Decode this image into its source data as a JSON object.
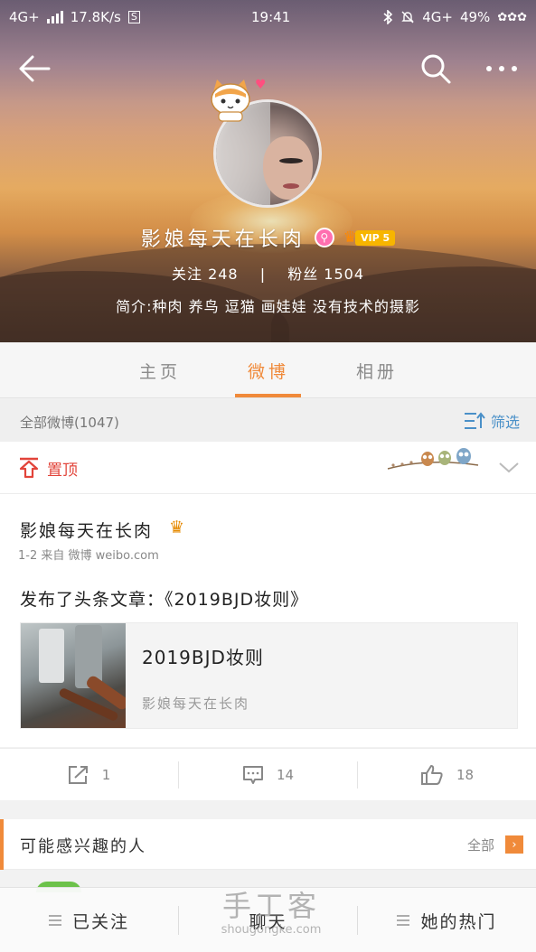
{
  "statusbar": {
    "network": "4G+",
    "speed": "17.8K/s",
    "s_badge": "S",
    "time": "19:41",
    "network2": "4G+",
    "battery": "49%"
  },
  "profile": {
    "username": "影娘每天在长肉",
    "vip_label": "VIP 5",
    "follow_text": "关注 248",
    "fans_text": "粉丝 1504",
    "divider": "|",
    "bio": "简介:种肉 养鸟 逗猫 画娃娃 没有技术的摄影"
  },
  "tabs": [
    {
      "label": "主页"
    },
    {
      "label": "微博"
    },
    {
      "label": "相册"
    }
  ],
  "filter": {
    "count_label": "全部微博(1047)",
    "filter_label": "筛选"
  },
  "pinned": {
    "label": "置顶"
  },
  "post": {
    "author": "影娘每天在长肉",
    "meta": "1-2  来自 微博 weibo.com",
    "text": "发布了头条文章：《2019BJD妆则》",
    "article_title": "2019BJD妆则",
    "article_author": "影娘每天在长肉",
    "repost_count": "1",
    "comment_count": "14",
    "like_count": "18"
  },
  "suggest": {
    "title": "可能感兴趣的人",
    "all_label": "全部"
  },
  "bottom": {
    "followed": "已关注",
    "chat": "聊天",
    "hot": "她的热门"
  },
  "watermark": {
    "brand": "手工客",
    "url": "shougongke.com"
  },
  "colors": {
    "accent": "#f08a3a",
    "pinned_red": "#e2443a",
    "filter_blue": "#4a90c8",
    "vip_gold": "#f7b500"
  }
}
